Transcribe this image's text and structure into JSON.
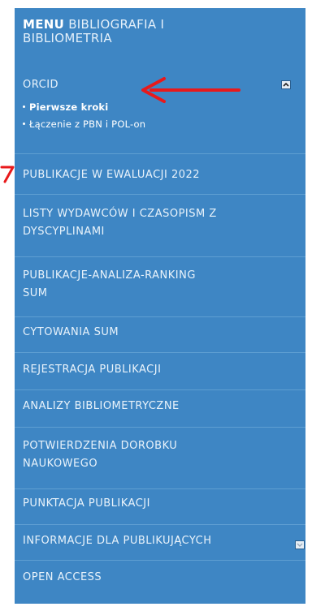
{
  "menu": {
    "title_bold": "MENU",
    "title_light_line1": "BIBLIOGRAFIA I",
    "title_light_line2": "BIBLIOMETRIA"
  },
  "orcid": {
    "label": "ORCID",
    "submenu": [
      "Pierwsze kroki",
      "Łączenie z PBN i POL-on"
    ]
  },
  "items": {
    "publikacje_ewaluacji": "PUBLIKACJE W EWALUACJI 2022",
    "listy_line1": "LISTY WYDAWCÓW I CZASOPISM Z",
    "listy_line2": "DYSCYPLINAMI",
    "analiza_line1": "PUBLIKACJE-ANALIZA-RANKING",
    "analiza_line2": "SUM",
    "cytowania": "CYTOWANIA SUM",
    "rejestracja": "REJESTRACJA PUBLIKACJI",
    "analizy": "ANALIZY BIBLIOMETRYCZNE",
    "potwierdzenia_line1": "POTWIERDZENIA DOROBKU",
    "potwierdzenia_line2": "NAUKOWEGO",
    "punktacja": "PUNKTACJA PUBLIKACJI",
    "informacje": "INFORMACJE DLA PUBLIKUJĄCYCH",
    "open_access": "OPEN ACCESS"
  },
  "colors": {
    "panel": "#3e86c4",
    "annotation_arrow": "#e8191b"
  },
  "icons": {
    "collapse": "chevron-up-icon",
    "expand": "chevron-down-icon"
  }
}
